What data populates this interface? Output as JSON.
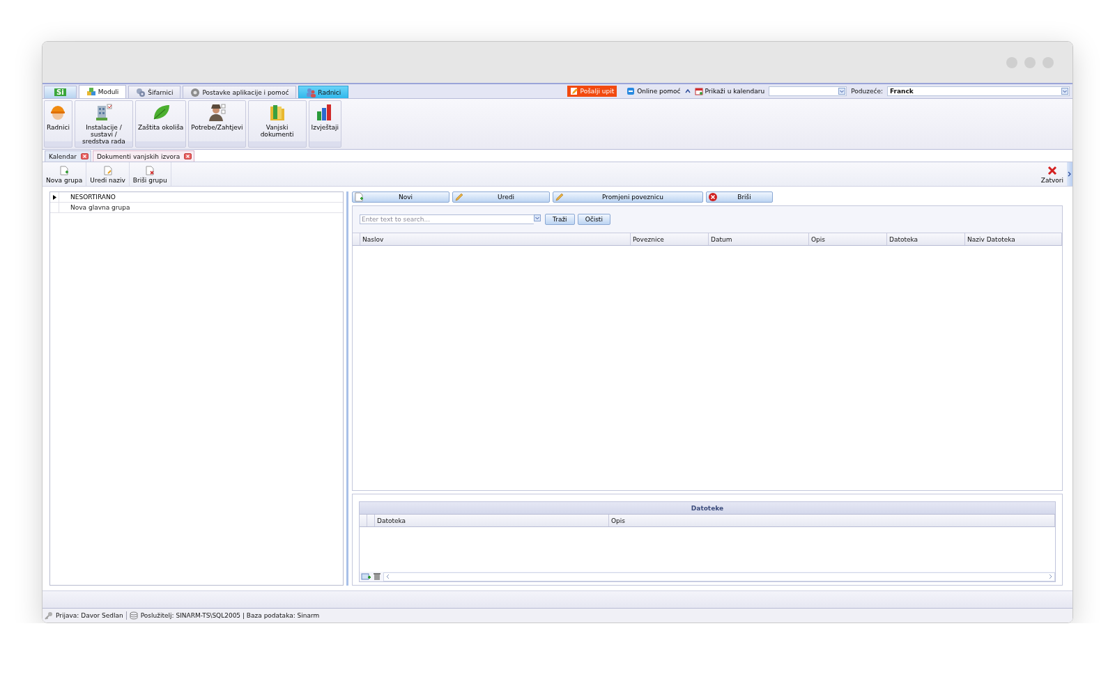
{
  "ribbon_tabs": [
    {
      "kind": "logo",
      "label": "Si",
      "selected": false
    },
    {
      "kind": "cubes",
      "label": "Moduli",
      "selected": true
    },
    {
      "kind": "gears",
      "label": "Šifarnici",
      "selected": false
    },
    {
      "kind": "gear",
      "label": "Postavke aplikacije i pomoć",
      "selected": false
    },
    {
      "kind": "context",
      "label": "Radnici",
      "selected": false
    }
  ],
  "quick_access": {
    "send_query": "Pošalji upit",
    "online_help": "Online pomoć",
    "calendar_label": "Prikaži u kalendaru",
    "company_label": "Poduzeće:",
    "company_value": "Franck"
  },
  "ribbon_buttons": [
    {
      "label": "Radnici",
      "kind": "worker"
    },
    {
      "label": "Instalacije / sustavi / sredstva rada",
      "kind": "building"
    },
    {
      "label": "Zaštita okoliša",
      "kind": "leaf"
    },
    {
      "label": "Potrebe/Zahtjevi",
      "kind": "agent"
    },
    {
      "label": "Vanjski dokumenti",
      "kind": "folder"
    },
    {
      "label": "Izvještaji",
      "kind": "chart"
    }
  ],
  "document_tabs": [
    {
      "label": "Kalendar",
      "selected": false
    },
    {
      "label": "Dokumenti vanjskih izvora",
      "selected": true
    }
  ],
  "toolbar": [
    {
      "label": "Nova grupa",
      "kind": "add"
    },
    {
      "label": "Uredi naziv",
      "kind": "edit"
    },
    {
      "label": "Briši grupu",
      "kind": "delete"
    }
  ],
  "close_button": "Zatvori",
  "tree": [
    {
      "label": "NESORTIRANO",
      "selected": true
    },
    {
      "label": "Nova glavna grupa",
      "selected": false
    }
  ],
  "actions": [
    {
      "label": "Novi",
      "kind": "add"
    },
    {
      "label": "Uredi",
      "kind": "pencil"
    },
    {
      "label": "Promjeni poveznicu",
      "kind": "pencil"
    },
    {
      "label": "Briši",
      "kind": "xred"
    }
  ],
  "search": {
    "placeholder": "Enter text to search...",
    "buttons": [
      "Traži",
      "Očisti"
    ]
  },
  "grid": {
    "columns": [
      "Naslov",
      "Poveznice",
      "Datum",
      "Opis",
      "Datoteka",
      "Naziv Datoteka"
    ]
  },
  "files": {
    "title": "Datoteke",
    "columns": [
      "Datoteka",
      "Opis"
    ]
  },
  "status_bar": [
    {
      "kind": "login",
      "text": "Prijava: Davor Sedlan"
    },
    {
      "kind": "server",
      "text": "Poslužitelj: SINARM-TS\\SQL2005 | Baza podataka: Sinarm"
    }
  ]
}
